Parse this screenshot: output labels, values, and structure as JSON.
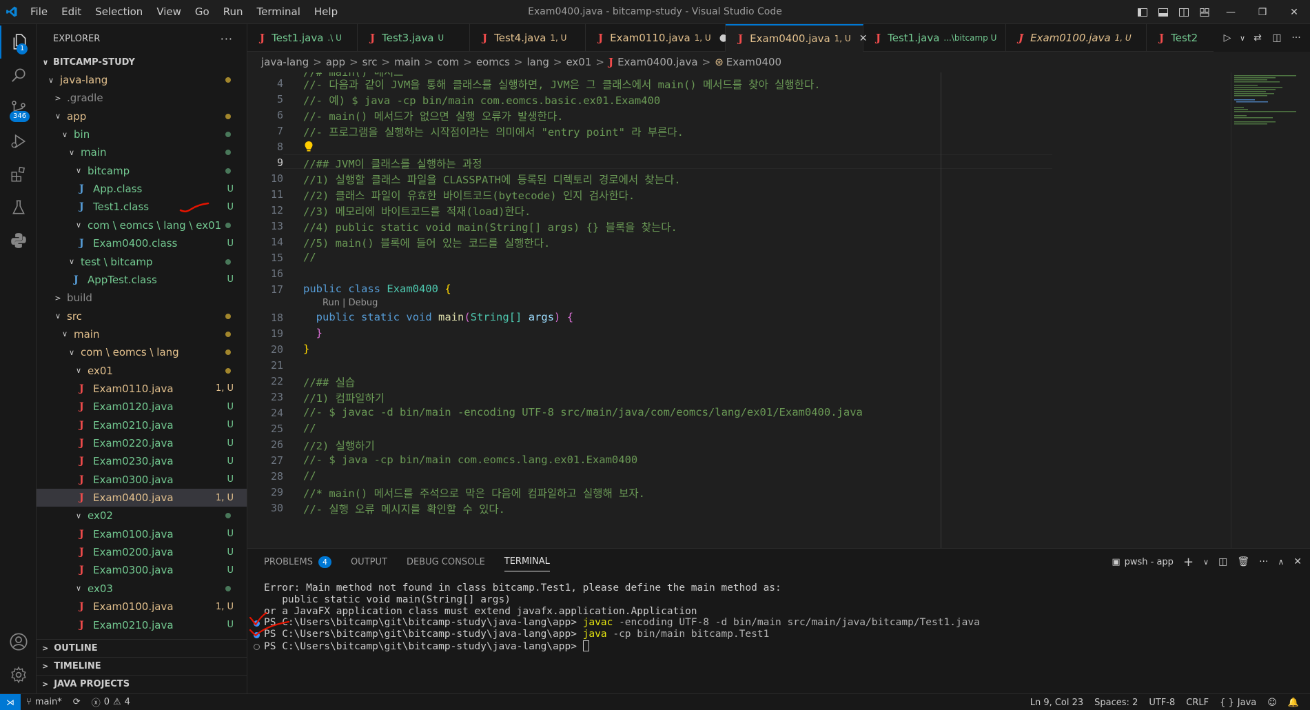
{
  "window": {
    "title": "Exam0400.java - bitcamp-study - Visual Studio Code",
    "menu": [
      "File",
      "Edit",
      "Selection",
      "View",
      "Go",
      "Run",
      "Terminal",
      "Help"
    ]
  },
  "activity_bar": {
    "explorer_badge": "1",
    "scm_badge": "346"
  },
  "explorer": {
    "title": "EXPLORER",
    "more": "···",
    "root": "BITCAMP-STUDY",
    "tree": [
      {
        "label": "java-lang",
        "chev": "∨",
        "status": "dot-y"
      },
      {
        "label": ".gradle",
        "chev": ">",
        "status": ""
      },
      {
        "label": "app",
        "chev": "∨",
        "status": "dot-y"
      },
      {
        "label": "bin",
        "chev": "∨",
        "status": "dot"
      },
      {
        "label": "main",
        "chev": "∨",
        "status": "dot"
      },
      {
        "label": "bitcamp",
        "chev": "∨",
        "status": "dot"
      },
      {
        "label": "App.class",
        "icon": "class",
        "status": "U"
      },
      {
        "label": "Test1.class",
        "icon": "class",
        "status": "U"
      },
      {
        "label": "com \\ eomcs \\ lang \\ ex01",
        "chev": "∨",
        "status": "dot"
      },
      {
        "label": "Exam0400.class",
        "icon": "class",
        "status": "U"
      },
      {
        "label": "test \\ bitcamp",
        "chev": "∨",
        "status": "dot"
      },
      {
        "label": "AppTest.class",
        "icon": "class",
        "status": "U"
      },
      {
        "label": "build",
        "chev": ">",
        "status": ""
      },
      {
        "label": "src",
        "chev": "∨",
        "status": "dot-y"
      },
      {
        "label": "main",
        "chev": "∨",
        "status": "dot-y"
      },
      {
        "label": "com \\ eomcs \\ lang",
        "chev": "∨",
        "status": "dot-y"
      },
      {
        "label": "ex01",
        "chev": "∨",
        "status": "dot-y"
      },
      {
        "label": "Exam0110.java",
        "icon": "java",
        "status": "1, U"
      },
      {
        "label": "Exam0120.java",
        "icon": "java",
        "status": "U"
      },
      {
        "label": "Exam0210.java",
        "icon": "java",
        "status": "U"
      },
      {
        "label": "Exam0220.java",
        "icon": "java",
        "status": "U"
      },
      {
        "label": "Exam0230.java",
        "icon": "java",
        "status": "U"
      },
      {
        "label": "Exam0300.java",
        "icon": "java",
        "status": "U"
      },
      {
        "label": "Exam0400.java",
        "icon": "java",
        "status": "1, U"
      },
      {
        "label": "ex02",
        "chev": "∨",
        "status": "dot"
      },
      {
        "label": "Exam0100.java",
        "icon": "java",
        "status": "U"
      },
      {
        "label": "Exam0200.java",
        "icon": "java",
        "status": "U"
      },
      {
        "label": "Exam0300.java",
        "icon": "java",
        "status": "U"
      },
      {
        "label": "ex03",
        "chev": "∨",
        "status": "dot"
      },
      {
        "label": "Exam0100.java",
        "icon": "java",
        "status": "1, U"
      },
      {
        "label": "Exam0210.java",
        "icon": "java",
        "status": "U"
      }
    ],
    "sections": [
      "OUTLINE",
      "TIMELINE",
      "JAVA PROJECTS"
    ]
  },
  "tabs": [
    {
      "name": "Test1.java",
      "suffix": ".\\ U"
    },
    {
      "name": "Test3.java",
      "suffix": "U"
    },
    {
      "name": "Test4.java",
      "suffix": "1, U"
    },
    {
      "name": "Exam0110.java",
      "suffix": "1, U"
    },
    {
      "name": "Exam0400.java",
      "suffix": "1, U"
    },
    {
      "name": "Test1.java",
      "suffix": "...\\bitcamp U"
    },
    {
      "name": "Exam0100.java",
      "suffix": "1, U"
    },
    {
      "name": "Test2",
      "suffix": ""
    }
  ],
  "breadcrumb": [
    "java-lang",
    "app",
    "src",
    "main",
    "com",
    "eomcs",
    "lang",
    "ex01",
    "Exam0400.java",
    "Exam0400"
  ],
  "editor": {
    "line_numbers": [
      "4",
      "5",
      "6",
      "7",
      "8",
      "9",
      "10",
      "11",
      "12",
      "13",
      "14",
      "15",
      "16",
      "17",
      "18",
      "19",
      "20",
      "21",
      "22",
      "23",
      "24",
      "25",
      "26",
      "27",
      "28",
      "29",
      "30"
    ],
    "partial_top": "//# main() 메서드",
    "lines": {
      "l4": "//- 다음과 같이 JVM을 통해 클래스를 실행하면, JVM은 그 클래스에서 main() 메서드를 찾아 실행한다.",
      "l5": "//- 예) $ java -cp bin/main com.eomcs.basic.ex01.Exam400",
      "l6": "//- main() 메서드가 없으면 실행 오류가 발생한다.",
      "l7": "//- 프로그램을 실행하는 시작점이라는 의미에서 \"entry point\" 라 부른다.",
      "l9": "//## JVM이 클래스를 실행하는 과정",
      "l10": "//1) 실행할 클래스 파일을 CLASSPATH에 등록된 디렉토리 경로에서 찾는다.",
      "l11": "//2) 클래스 파일이 유효한 바이트코드(bytecode) 인지 검사한다.",
      "l12": "//3) 메모리에 바이트코드를 적재(load)한다.",
      "l13": "//4) public static void main(String[] args) {} 블록을 찾는다.",
      "l14": "//5) main() 블록에 들어 있는 코드를 실행한다.",
      "l15": "//",
      "l17_kw1": "public",
      "l17_kw2": "class",
      "l17_name": "Exam0400",
      "l17_brace": "{",
      "codelens": "Run | Debug",
      "l18_kw1": "public",
      "l18_kw2": "static",
      "l18_kw3": "void",
      "l18_fn": "main",
      "l18_open": "(",
      "l18_type": "String[]",
      "l18_param": "args",
      "l18_close": ")",
      "l18_brace": "{",
      "l19": "}",
      "l20": "}",
      "l22": "//## 실습",
      "l23": "//1) 컴파일하기",
      "l24": "//- $ javac -d bin/main -encoding UTF-8 src/main/java/com/eomcs/lang/ex01/Exam0400.java",
      "l25": "//",
      "l26": "//2) 실행하기",
      "l27": "//- $ java -cp bin/main com.eomcs.lang.ex01.Exam0400",
      "l28": "//",
      "l29": "//* main() 메서드를 주석으로 막은 다음에 컴파일하고 실행해 보자.",
      "l30": "//- 실행 오류 메시지를 확인할 수 있다."
    }
  },
  "panel": {
    "tabs": [
      "PROBLEMS",
      "OUTPUT",
      "DEBUG CONSOLE",
      "TERMINAL"
    ],
    "problems_count": "4",
    "terminal_name": "pwsh - app",
    "terminal": {
      "t1": "Error: Main method not found in class bitcamp.Test1, please define the main method as:",
      "t2": "   public static void main(String[] args)",
      "t3": "or a JavaFX application class must extend javafx.application.Application",
      "prompt": "PS C:\\Users\\bitcamp\\git\\bitcamp-study\\java-lang\\app>",
      "cmd1_a": "javac",
      "cmd1_b": " -encoding UTF-8 -d bin/main src/main/java/bitcamp/Test1.java",
      "cmd2_a": "java",
      "cmd2_b": " -cp bin/main bitcamp.Test1"
    }
  },
  "status": {
    "branch": "main*",
    "errors": "0",
    "warnings": "4",
    "position": "Ln 9, Col 23",
    "spaces": "Spaces: 2",
    "encoding": "UTF-8",
    "eol": "CRLF",
    "language": "Java"
  },
  "colors": {
    "accent": "#0078d4",
    "modified": "#e2c08d",
    "untracked": "#73c991",
    "java_icon": "#f14c4c",
    "annotation": "#e51400"
  }
}
